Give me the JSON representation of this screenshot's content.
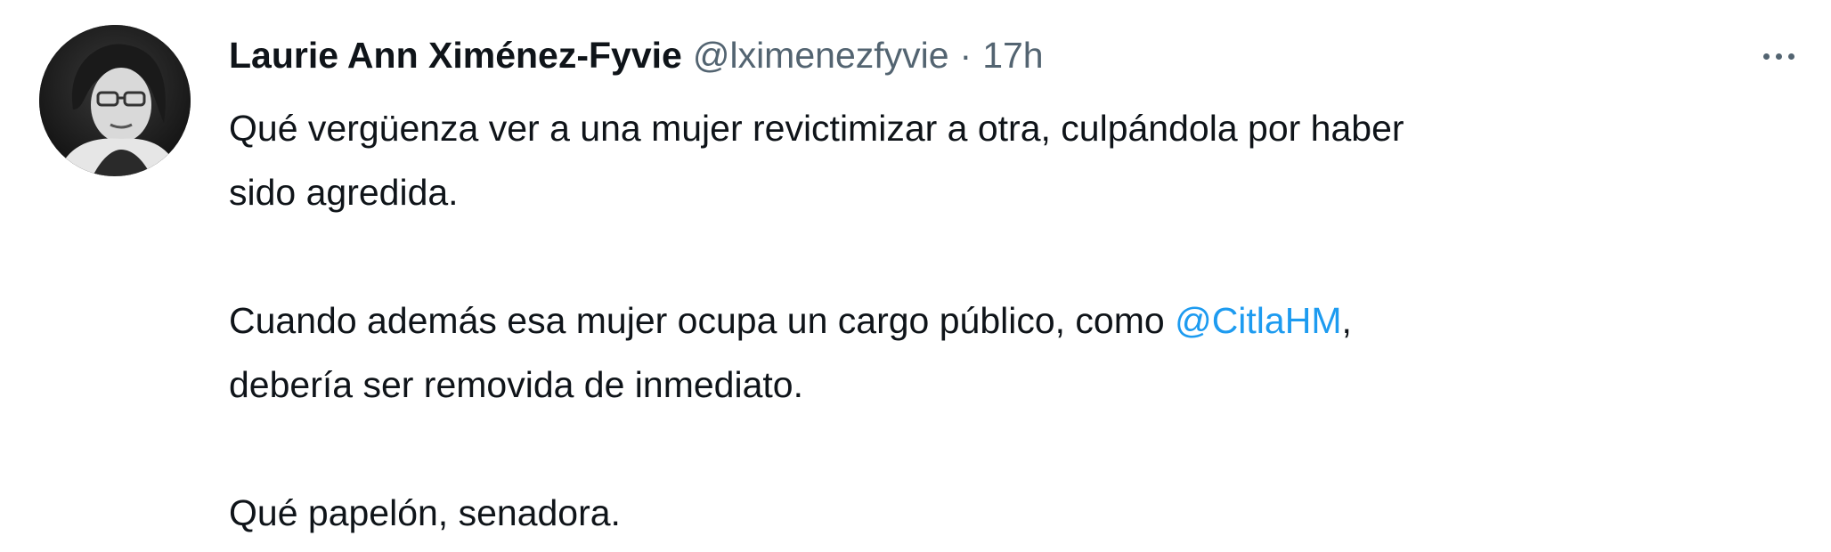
{
  "tweet": {
    "author_name": "Laurie Ann Ximénez-Fyvie",
    "handle": "@lximenezfyvie",
    "separator": "·",
    "time": "17h",
    "body": {
      "p1_line1": "Qué vergüenza ver a una mujer revictimizar a otra, culpándola por haber",
      "p1_line2": "sido agredida.",
      "p2_line1_before": "Cuando además esa mujer ocupa un cargo público, como ",
      "p2_mention": "@CitlaHM",
      "p2_line1_after": ",",
      "p2_line2": "debería ser removida de inmediato.",
      "p3_line1": "Qué papelón, senadora."
    },
    "more_icon": "more-horizontal-icon",
    "colors": {
      "text": "#0f1419",
      "secondary": "#536471",
      "link": "#1d9bf0",
      "background": "#ffffff"
    }
  }
}
